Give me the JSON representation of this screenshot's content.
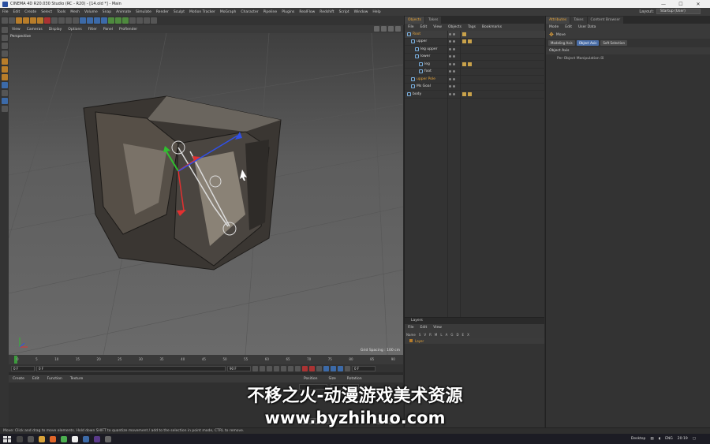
{
  "window": {
    "title": "CINEMA 4D R20.030 Studio (RC - R20) - [14.old *] - Main",
    "controls": [
      "—",
      "☐",
      "✕"
    ]
  },
  "menu": [
    "File",
    "Edit",
    "Create",
    "Select",
    "Tools",
    "Mesh",
    "Volume",
    "Snap",
    "Animate",
    "Simulate",
    "Render",
    "Sculpt",
    "Motion Tracker",
    "MoGraph",
    "Character",
    "Pipeline",
    "Plugins",
    "RealFlow",
    "Redshift",
    "Script",
    "Window",
    "Help"
  ],
  "layout": {
    "label": "Layout:",
    "value": "Startup (User)"
  },
  "viewport": {
    "menu": [
      "View",
      "Cameras",
      "Display",
      "Options",
      "Filter",
      "Panel",
      "ProRender"
    ],
    "label": "Perspective",
    "grid_spacing": "Grid Spacing : 100 cm"
  },
  "timeline": {
    "ticks": [
      "0",
      "5",
      "10",
      "15",
      "20",
      "25",
      "30",
      "35",
      "40",
      "45",
      "50",
      "55",
      "60",
      "65",
      "70",
      "75",
      "80",
      "85",
      "90"
    ],
    "current_frame": "0 F",
    "range_start": "0 F",
    "range_end": "90 F",
    "end_field": "90 F",
    "right_field": "0 F"
  },
  "materials": {
    "menu": [
      "Create",
      "Edit",
      "Function",
      "Texture"
    ]
  },
  "coordinates": {
    "headers": [
      "Position",
      "Size",
      "Rotation"
    ]
  },
  "object_manager": {
    "tabs": [
      "Objects",
      "Takes"
    ],
    "menu": [
      "File",
      "Edit",
      "View",
      "Objects",
      "Tags",
      "Bookmarks"
    ],
    "items": [
      {
        "name": "Root",
        "indent": 0,
        "orange": true
      },
      {
        "name": "upper",
        "indent": 1,
        "orange": false
      },
      {
        "name": "leg upper",
        "indent": 2,
        "orange": false
      },
      {
        "name": "lower",
        "indent": 2,
        "orange": false
      },
      {
        "name": "leg",
        "indent": 3,
        "orange": false
      },
      {
        "name": "foot",
        "indent": 3,
        "orange": false
      },
      {
        "name": "upper Pole",
        "indent": 1,
        "orange": true
      },
      {
        "name": "Ms Goal",
        "indent": 1,
        "orange": false
      },
      {
        "name": "body",
        "indent": 0,
        "orange": false
      }
    ]
  },
  "layers": {
    "title": "Layers",
    "menu": [
      "File",
      "Edit",
      "View"
    ],
    "columns": [
      "Name",
      "S",
      "V",
      "R",
      "M",
      "L",
      "A",
      "G",
      "D",
      "E",
      "X"
    ],
    "rows": [
      {
        "name": "Layer"
      }
    ]
  },
  "attributes": {
    "tabs": [
      "Attributes",
      "Takes",
      "Content Browser"
    ],
    "menu": [
      "Mode",
      "Edit",
      "User Data"
    ],
    "mode_label": "Move",
    "mode_buttons": [
      "Modeling Axis",
      "Object Axis",
      "Soft Selection"
    ],
    "section": "Object Axis",
    "option": "Per Object Manipulation ☒"
  },
  "status": "Move: Click and drag to move elements. Hold down SHIFT to quantize movement / add to the selection in point mode, CTRL to remove.",
  "taskbar": {
    "desktop": "Desktop",
    "lang": "ENG",
    "time": "20:19"
  },
  "watermark": {
    "line1": "不移之火-动漫游戏美术资源",
    "line2": "www.byzhihuo.com"
  },
  "colors": {
    "accent_orange": "#e6a43a",
    "selection_blue": "#4a6ea8",
    "panel": "#333333"
  }
}
